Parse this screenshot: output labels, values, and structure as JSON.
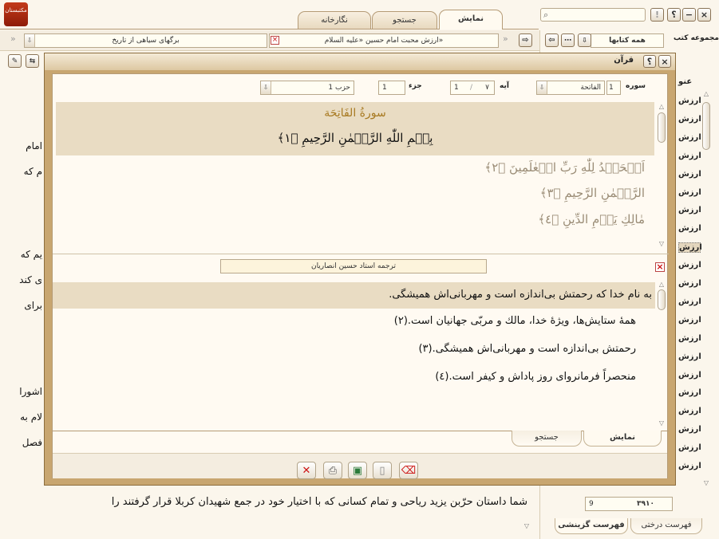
{
  "app": {
    "logo_text": "مکتبستان",
    "window_controls": [
      "×",
      "−",
      "؟",
      "!"
    ]
  },
  "main_tabs": [
    {
      "label": "نمایش",
      "active": true
    },
    {
      "label": "جستجو",
      "active": false
    },
    {
      "label": "نگارخانه",
      "active": false
    }
  ],
  "search": {
    "value": ""
  },
  "right_panel": {
    "collection_label": "مجموعه کتب",
    "collection_value": "همه کتابها",
    "list_header": "عنو",
    "list_items": [
      "ارزش",
      "ارزش",
      "ارزش",
      "ارزش",
      "ارزش",
      "ارزش",
      "ارزش",
      "ارزش",
      "ارزش",
      "ارزش",
      "ارزش",
      "ارزش",
      "ارزش",
      "ارزش",
      "ارزش",
      "ارزش",
      "ارزش",
      "ارزش",
      "ارزش",
      "ارزش",
      "ارزش"
    ],
    "selected_index": 8,
    "counter_left": "9",
    "counter_right": "۳۹۱۰",
    "bottom_tabs": [
      "فهرست درختی",
      "فهرست گزینشی"
    ]
  },
  "doc_bar": {
    "title": "ارزش محبت امام حسین «علیه السلام»",
    "bookmarks": "برگهای سیاهی از تاریخ"
  },
  "background_text": {
    "frag1": "امام",
    "frag2": "م که",
    "frag3": "یم که",
    "frag4": "ی کند",
    "frag5": "برای",
    "frag6": "اشورا",
    "frag7": "لام به",
    "frag8": "فصل",
    "bottom_line": "شما داستان حرّبن یزید ریاحی و تمام کسانی که با اختیار خود در جمع  شهیدان کربلا قرار گرفتند را"
  },
  "quran_window": {
    "title": "قرآن",
    "surah_label": "سوره",
    "surah_number": "1",
    "surah_name": "الفاتحة",
    "ayah_label": "آیه",
    "ayah_from": "1",
    "ayah_to": "۷",
    "juz_label": "جزء",
    "juz_value": "1",
    "hizb_value": "حزب 1",
    "surah_heading": "سورةُ الفَاتِحَة",
    "verses": [
      "بِسۡمِ اللّٰهِ الرَّحۡمٰنِ الرَّحِيمِ ﴿١﴾",
      "اَلۡحَمۡدُ لِلّٰهِ رَبِّ الۡعٰلَمِينَ ﴿٢﴾",
      "الرَّحۡمٰنِ الرَّحِيمِ ﴿٣﴾",
      "مٰالِكِ يَوۡمِ الدِّينِ ﴿٤﴾"
    ],
    "translator": "ترجمه استاد حسین انصاریان",
    "translations": [
      "به نام خدا که رحمتش بی‌اندازه است و مهربانی‌اش همیشگی.",
      "همهٔ ستایش‌ها، ویژهٔ خدا، مالك و مربّی جهانیان است.(۲)",
      "رحمتش بی‌اندازه است و مهربانی‌اش همیشگی.(۳)",
      "منحصراً فرمانروای روز پاداش و کیفر است.(٤)"
    ],
    "tabs": [
      "نمایش",
      "جستجو"
    ]
  },
  "colors": {
    "frame": "#c8a670",
    "highlight": "#e9dcc3",
    "gold": "#a87a22",
    "close_red": "#cc1111"
  }
}
